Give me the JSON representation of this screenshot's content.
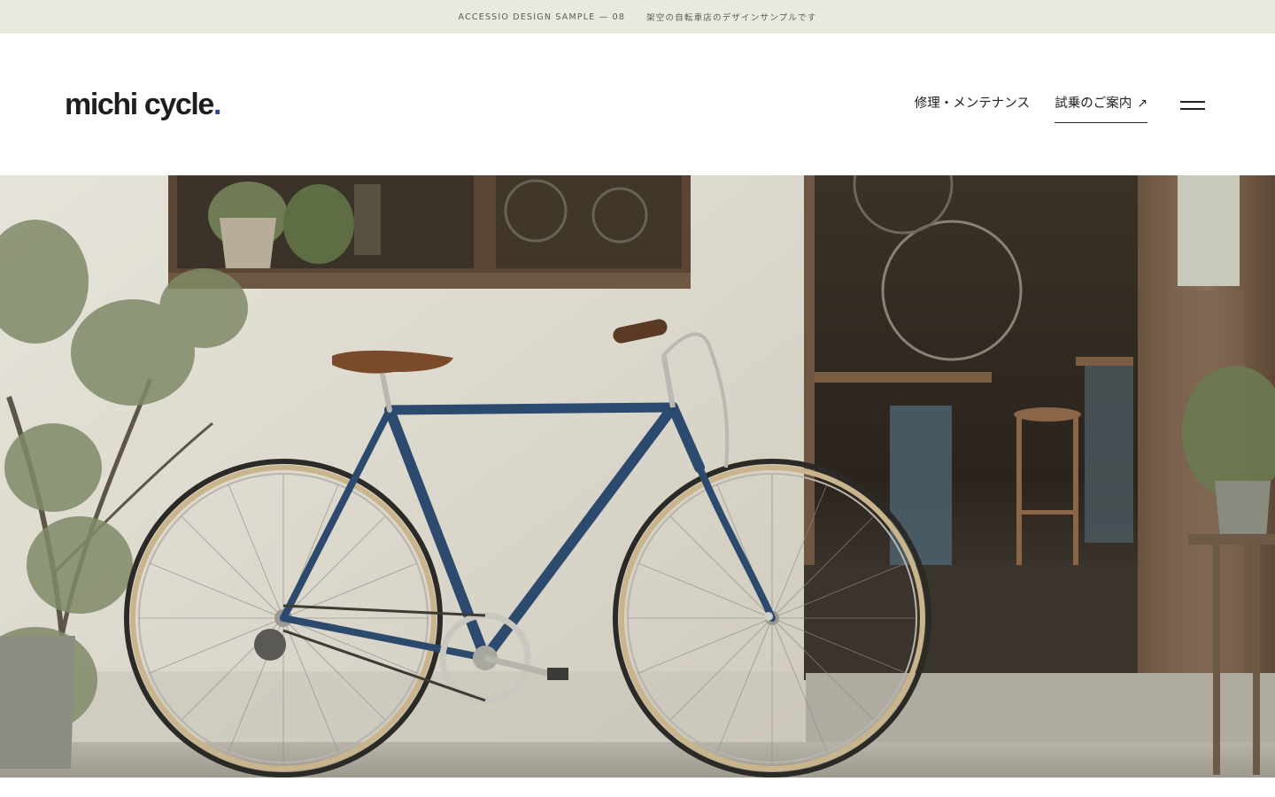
{
  "topbar": {
    "sample_label": "ACCESSIO DESIGN SAMPLE — 08",
    "note": "架空の自転車店のデザインサンプルです"
  },
  "header": {
    "logo_text": "michi cycle",
    "logo_dot": ".",
    "nav": {
      "repair": "修理・メンテナンス",
      "trial": "試乗のご案内"
    },
    "menu_icon": "hamburger-icon",
    "external_icon": "arrow-northeast-icon"
  },
  "hero": {
    "image_subject": "blue city bicycle with brown leather saddle leaning against a white plaster wall beside an open bicycle workshop door"
  },
  "colors": {
    "topbar_bg": "#e9e9df",
    "logo_dot": "#2a4a8f",
    "bike_frame": "#2c4a6e",
    "saddle": "#7a4a2a"
  }
}
